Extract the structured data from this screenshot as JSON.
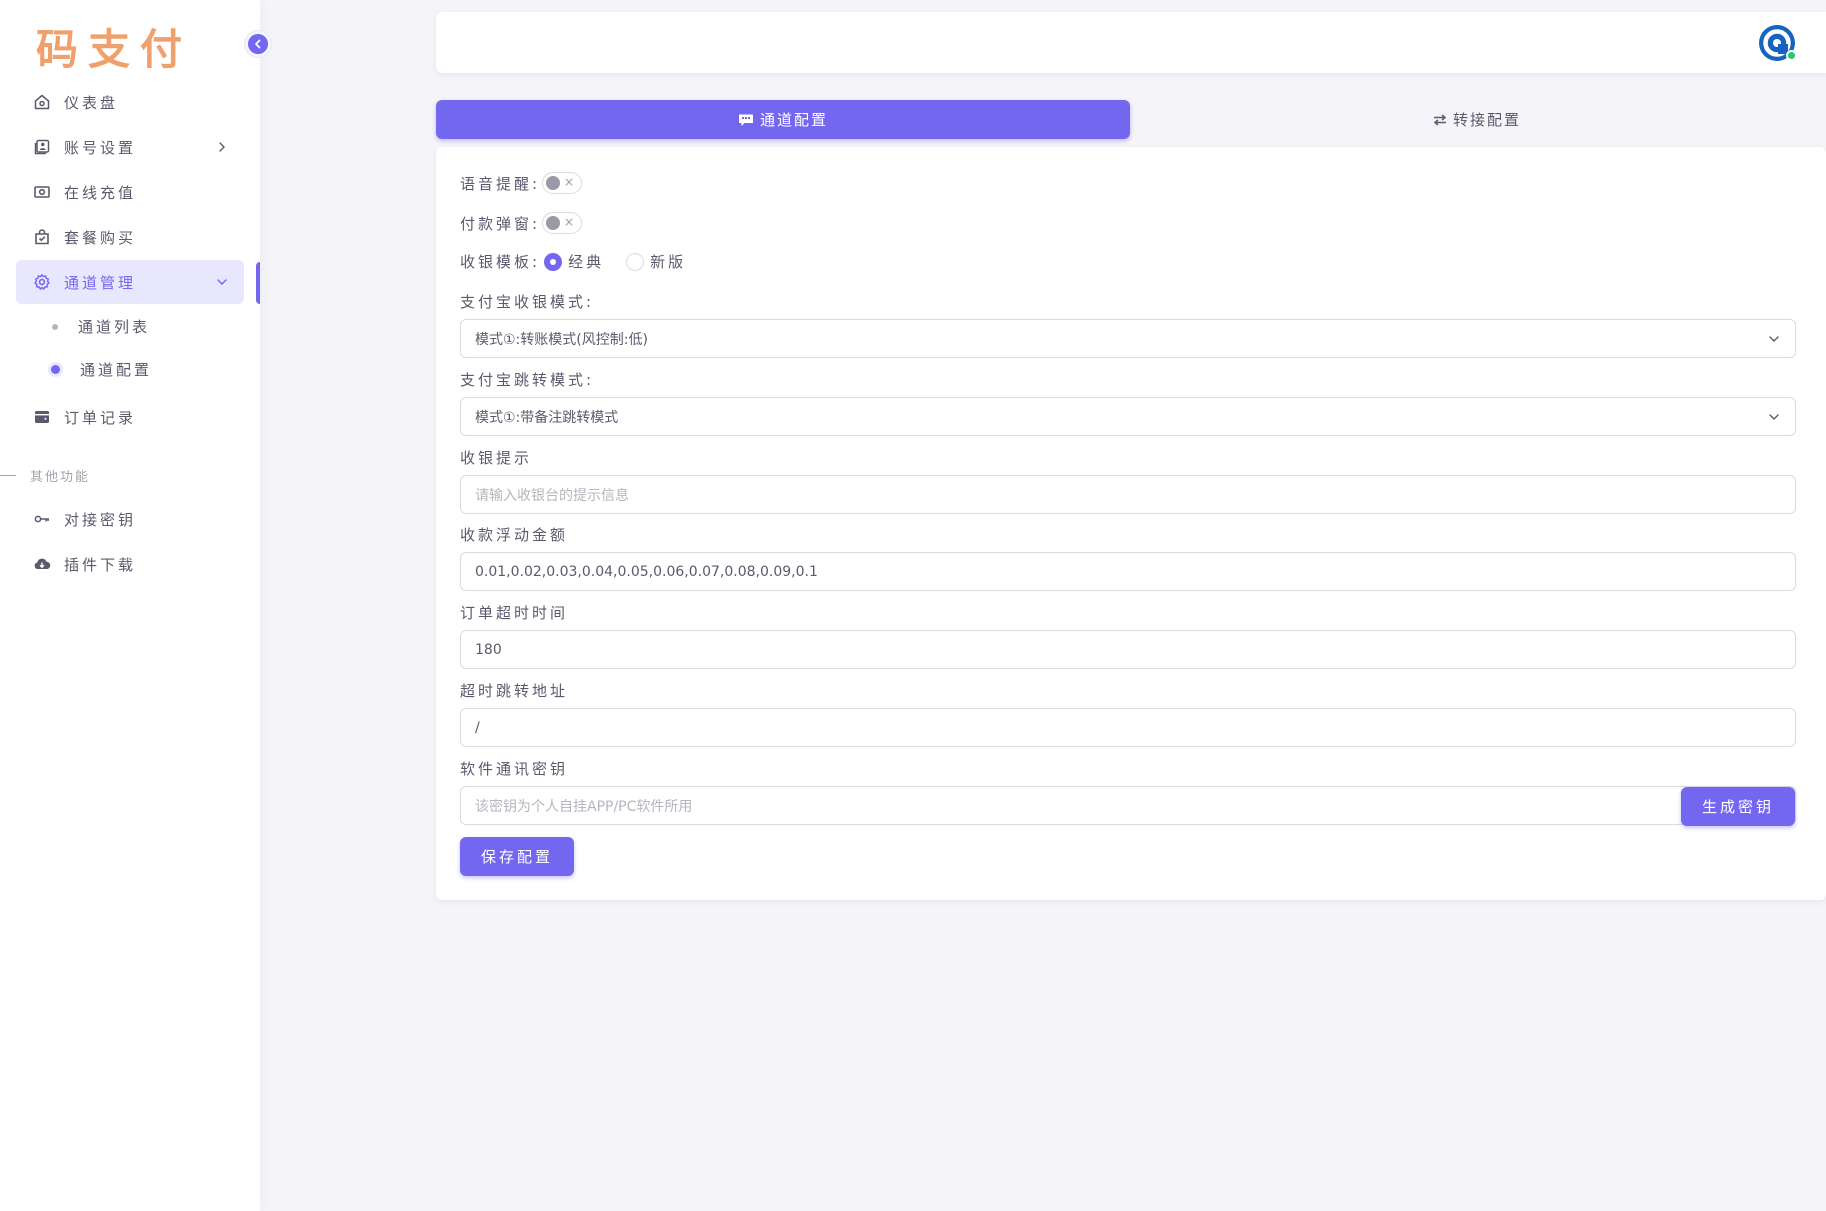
{
  "brand": {
    "logo_text": "码支付"
  },
  "sidebar": {
    "items": [
      {
        "label": "仪表盘",
        "icon": "home-icon"
      },
      {
        "label": "账号设置",
        "icon": "user-profile-icon"
      },
      {
        "label": "在线充值",
        "icon": "cash-icon"
      },
      {
        "label": "套餐购买",
        "icon": "shopping-bag-icon"
      },
      {
        "label": "通道管理",
        "icon": "settings-gear-icon"
      },
      {
        "label": "订单记录",
        "icon": "wallet-icon"
      }
    ],
    "submenu": [
      {
        "label": "通道列表"
      },
      {
        "label": "通道配置"
      }
    ],
    "section_header": "其他功能",
    "extra_items": [
      {
        "label": "对接密钥",
        "icon": "key-icon"
      },
      {
        "label": "插件下载",
        "icon": "cloud-download-icon"
      }
    ]
  },
  "tabs": [
    {
      "label": "通道配置",
      "icon": "message-icon",
      "active": true
    },
    {
      "label": "转接配置",
      "icon": "swap-arrows-icon",
      "active": false
    }
  ],
  "form": {
    "voice_reminder": {
      "label": "语音提醒:",
      "enabled": false,
      "off_glyph": "×"
    },
    "payment_popup": {
      "label": "付款弹窗:",
      "enabled": false,
      "off_glyph": "×"
    },
    "cashier_template": {
      "label": "收银模板:",
      "options": [
        "经典",
        "新版"
      ],
      "selected": "经典"
    },
    "alipay_cashier_mode": {
      "label": "支付宝收银模式:",
      "value": "模式①:转账模式(风控制:低)"
    },
    "alipay_jump_mode": {
      "label": "支付宝跳转模式:",
      "value": "模式①:带备注跳转模式"
    },
    "cashier_tip": {
      "label": "收银提示",
      "placeholder": "请输入收银台的提示信息",
      "value": ""
    },
    "float_amount": {
      "label": "收款浮动金额",
      "value": "0.01,0.02,0.03,0.04,0.05,0.06,0.07,0.08,0.09,0.1"
    },
    "order_timeout": {
      "label": "订单超时时间",
      "value": "180"
    },
    "timeout_redirect": {
      "label": "超时跳转地址",
      "value": "/"
    },
    "software_key": {
      "label": "软件通讯密钥",
      "placeholder": "该密钥为个人自挂APP/PC软件所用",
      "value": "",
      "generate_label": "生成密钥"
    },
    "save_label": "保存配置"
  },
  "colors": {
    "primary": "#7367f0",
    "logo": "#f0a06c",
    "background": "#f4f4f9",
    "online": "#28c76f"
  }
}
